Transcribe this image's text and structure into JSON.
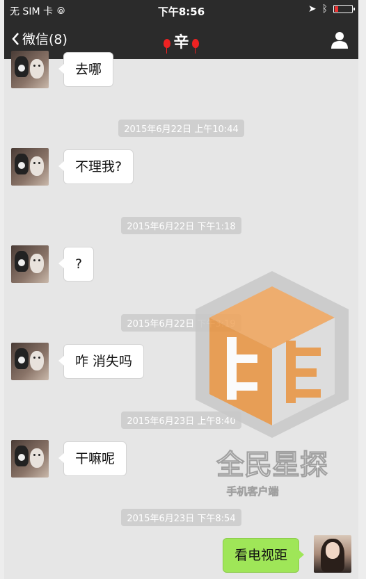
{
  "status_bar": {
    "carrier": "无 SIM 卡",
    "time": "下午8:56"
  },
  "nav": {
    "back_label": "微信(8)",
    "title": "辛"
  },
  "messages": [
    {
      "type": "in",
      "text": "去哪"
    },
    {
      "type": "time",
      "text": "2015年6月22日 上午10:44"
    },
    {
      "type": "in",
      "text": "不理我?"
    },
    {
      "type": "time",
      "text": "2015年6月22日 下午1:18"
    },
    {
      "type": "in",
      "text": "?"
    },
    {
      "type": "time",
      "text": "2015年6月22日 下午3:19"
    },
    {
      "type": "in",
      "text": "咋 消失吗"
    },
    {
      "type": "time",
      "text": "2015年6月23日 上午8:40"
    },
    {
      "type": "in",
      "text": "干嘛呢"
    },
    {
      "type": "time",
      "text": "2015年6月23日 下午8:54"
    },
    {
      "type": "out",
      "text": "看电视距"
    }
  ],
  "watermark": {
    "title": "全民星探",
    "subtitle": "手机客户端"
  },
  "colors": {
    "bar": "#2b2b2b",
    "outgoing_bubble": "#9fe658",
    "background": "#e6e6e6"
  }
}
